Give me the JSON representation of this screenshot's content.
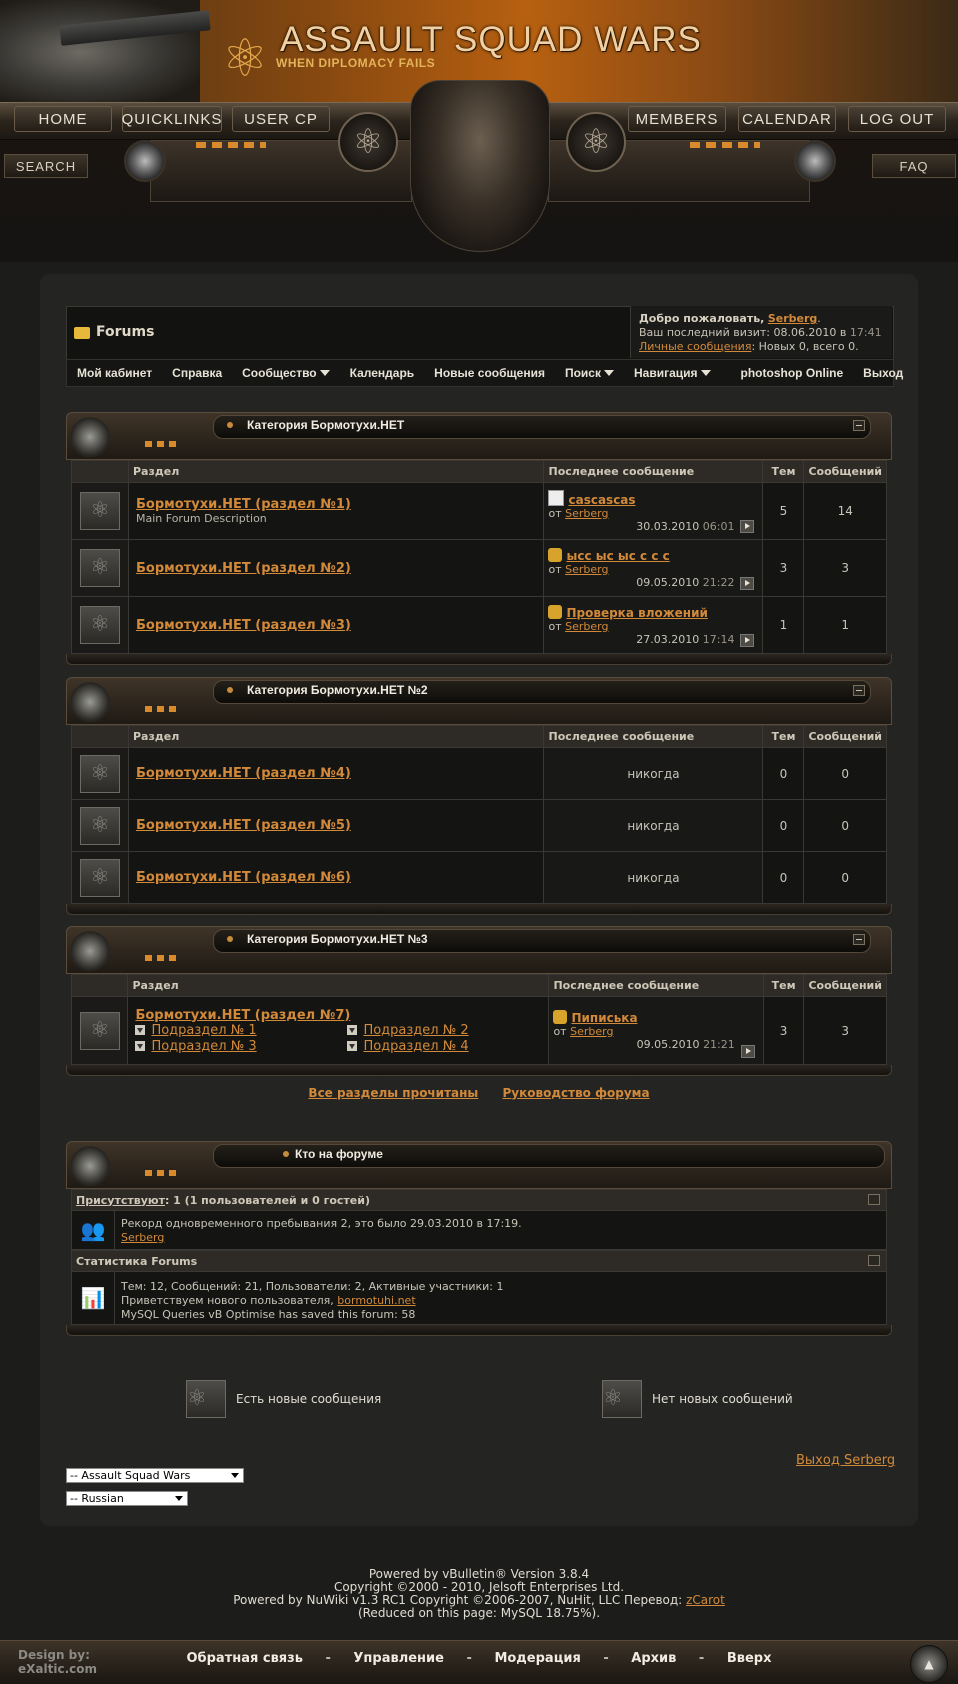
{
  "header": {
    "site_title": "ASSAULT SQUAD WARS",
    "site_subtitle": "WHEN DIPLOMACY FAILS",
    "nav_top": [
      "HOME",
      "QUICKLINKS",
      "USER CP",
      "MEMBERS",
      "CALENDAR",
      "LOG OUT"
    ],
    "nav_side": [
      "SEARCH",
      "FAQ"
    ]
  },
  "breadcrumb": {
    "label": "Forums"
  },
  "welcome": {
    "greeting": "Добро пожаловать,",
    "username": "Serberg",
    "dot": ".",
    "last_visit_label": "Ваш последний визит: 08.06.2010 в",
    "last_visit_time": "17:41",
    "pm_link": "Личные сообщения",
    "pm_text": ": Новых 0, всего 0."
  },
  "navstrip": {
    "items": [
      "Мой кабинет",
      "Справка",
      "Сообщество",
      "Календарь",
      "Новые сообщения",
      "Поиск",
      "Навигация",
      "photoshop Online",
      "Выход"
    ]
  },
  "table_headers": {
    "section": "Раздел",
    "last_post": "Последнее сообщение",
    "threads": "Тем",
    "posts": "Сообщений"
  },
  "categories": [
    {
      "title": "Категория Бормотухи.НЕТ",
      "forums": [
        {
          "name": "Бормотухи.НЕТ (раздел №1)",
          "desc": "Main Forum Description",
          "last_title": "cascascas",
          "by": "от",
          "user": "Serberg",
          "date": "30.03.2010",
          "time": "06:01",
          "threads": "5",
          "posts": "14"
        },
        {
          "name": "Бормотухи.НЕТ (раздел №2)",
          "desc": "",
          "last_title": "ысс ыс ыс с с с",
          "by": "от",
          "user": "Serberg",
          "date": "09.05.2010",
          "time": "21:22",
          "threads": "3",
          "posts": "3"
        },
        {
          "name": "Бормотухи.НЕТ (раздел №3)",
          "desc": "",
          "last_title": "Проверка вложений",
          "by": "от",
          "user": "Serberg",
          "date": "27.03.2010",
          "time": "17:14",
          "threads": "1",
          "posts": "1"
        }
      ]
    },
    {
      "title": "Категория Бормотухи.НЕТ №2",
      "forums": [
        {
          "name": "Бормотухи.НЕТ (раздел №4)",
          "never": "никогда",
          "threads": "0",
          "posts": "0"
        },
        {
          "name": "Бормотухи.НЕТ (раздел №5)",
          "never": "никогда",
          "threads": "0",
          "posts": "0"
        },
        {
          "name": "Бормотухи.НЕТ (раздел №6)",
          "never": "никогда",
          "threads": "0",
          "posts": "0"
        }
      ]
    },
    {
      "title": "Категория Бормотухи.НЕТ №3",
      "forums": [
        {
          "name": "Бормотухи.НЕТ (раздел №7)",
          "subforums": [
            "Подраздел № 1",
            "Подраздел № 2",
            "Подраздел № 3",
            "Подраздел № 4"
          ],
          "last_title": "Пиписька",
          "by": "от",
          "user": "Serberg",
          "date": "09.05.2010",
          "time": "21:21",
          "threads": "3",
          "posts": "3"
        }
      ]
    }
  ],
  "links": {
    "mark_read": "Все разделы прочитаны",
    "guide": "Руководство форума"
  },
  "online": {
    "title": "Кто на форуме",
    "present_link": "Присутствуют",
    "present_text": ": 1 (1 пользователей и 0 гостей)",
    "record": "Рекорд одновременного пребывания 2, это было 29.03.2010 в 17:19.",
    "record_user": "Serberg",
    "stats_title": "Статистика Forums",
    "stats_line": "Тем: 12, Сообщений: 21, Пользователи: 2, Активные участники: 1",
    "welcome_new": "Приветствуем нового пользователя,",
    "new_user": "bormotuhi.net",
    "mysql_line": "MySQL Queries vB Optimise has saved this forum: 58"
  },
  "legend": {
    "new_posts": "Есть новые сообщения",
    "no_new_posts": "Нет новых сообщений"
  },
  "logout_link": "Выход Serberg",
  "selects": {
    "style": "-- Assault Squad Wars",
    "language": "-- Russian"
  },
  "credits": {
    "line1": "Powered by vBulletin® Version 3.8.4",
    "line2": "Copyright ©2000 - 2010, Jelsoft Enterprises Ltd.",
    "line3": "Powered by NuWiki v1.3 RC1 Copyright ©2006-2007, NuHit, LLC Перевод:",
    "translator": "zCarot",
    "line4": "(Reduced on this page: MySQL 18.75%)."
  },
  "footer": {
    "designed_by": "Design by:",
    "designer": "eXaltic.com",
    "links": [
      "Обратная связь",
      "Управление",
      "Модерация",
      "Архив",
      "Вверх"
    ],
    "sep": "-"
  },
  "colors": {
    "accent": "#d28a3a",
    "bg": "#1c1c1a",
    "panel": "#242422",
    "header_bar": "#2e2b27"
  }
}
